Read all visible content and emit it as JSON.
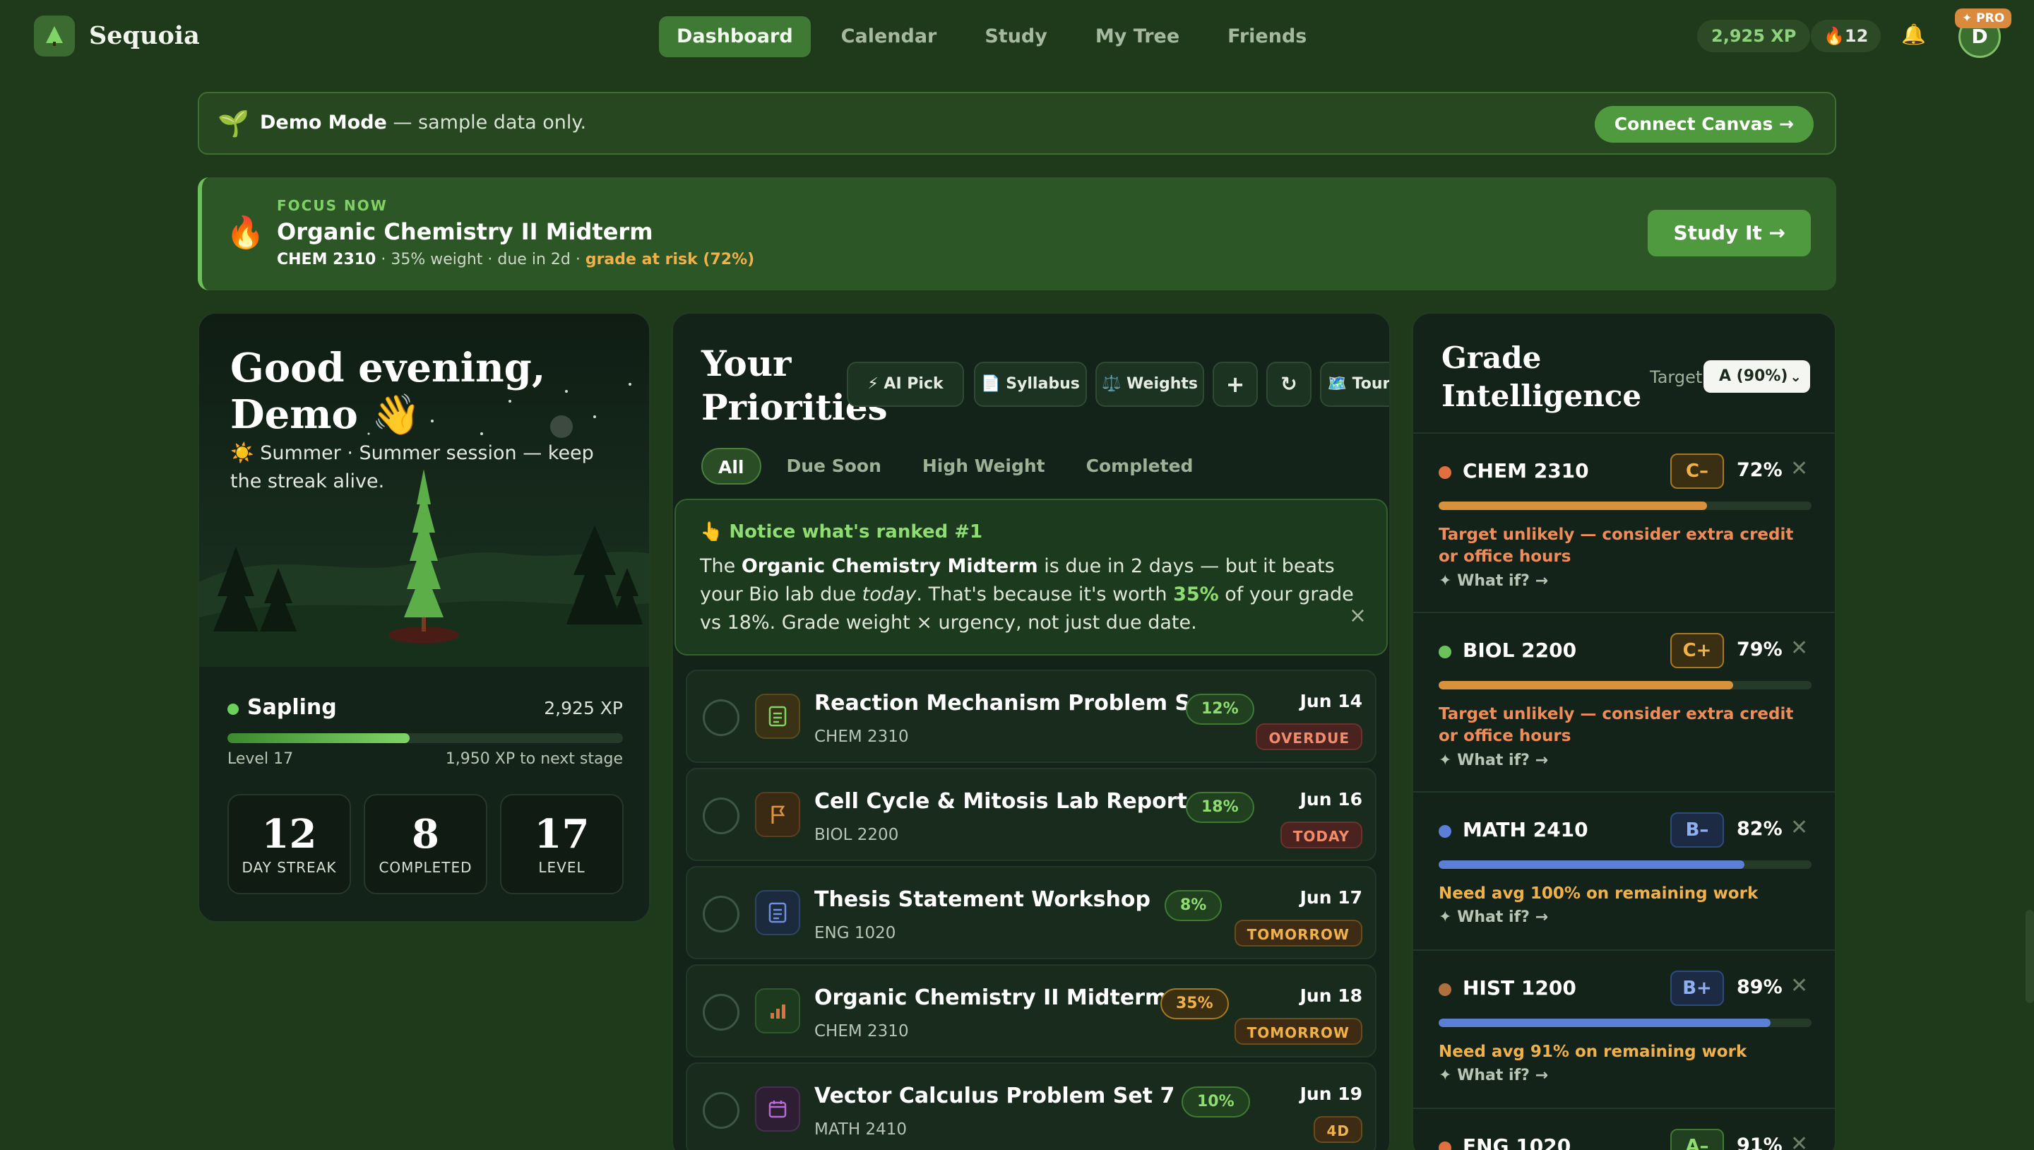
{
  "brand": {
    "name": "Sequoia"
  },
  "nav": {
    "tabs": [
      "Dashboard",
      "Calendar",
      "Study",
      "My Tree",
      "Friends"
    ],
    "active": "Dashboard"
  },
  "header": {
    "xp": "2,925 XP",
    "streak": "🔥12",
    "pro_badge": "✦ PRO",
    "avatar_initial": "D",
    "bell": "🔔"
  },
  "demo": {
    "icon": "🌱",
    "title": "Demo Mode",
    "text": "— sample data only.",
    "button": "Connect Canvas →"
  },
  "focus": {
    "icon": "🔥",
    "kicker": "FOCUS NOW",
    "title": "Organic Chemistry II Midterm",
    "course": "CHEM 2310",
    "meta": " · 35% weight · due in 2d · ",
    "risk": "grade at risk (72%)",
    "button": "Study It →"
  },
  "greeting": {
    "title": "Good evening, Demo 👋",
    "subtitle": "☀️ Summer · Summer session — keep the streak alive.",
    "stage": "Sapling",
    "xp": "2,925 XP",
    "progress": 0.46,
    "level": "Level 17",
    "next": "1,950 XP to next stage",
    "stats": [
      {
        "num": "12",
        "label": "DAY STREAK"
      },
      {
        "num": "8",
        "label": "COMPLETED"
      },
      {
        "num": "17",
        "label": "LEVEL"
      }
    ]
  },
  "priorities": {
    "title": "Your Priorities",
    "tools": {
      "ai": "⚡ AI Pick",
      "syllabus": "📄 Syllabus",
      "weights": "⚖️ Weights",
      "add": "+",
      "refresh": "↻",
      "tour": "🗺️ Tour"
    },
    "filters": [
      "All",
      "Due Soon",
      "High Weight",
      "Completed"
    ],
    "notice": {
      "heading": "👆 Notice what's ranked #1",
      "p1": "The ",
      "bold": "Organic Chemistry Midterm",
      "p2": " is due in 2 days — but it beats your Bio lab due ",
      "italic": "today",
      "p3": ". That's because it's worth ",
      "pct": "35%",
      "p4": " of your grade vs 18%. Grade weight × urgency, not just due date.",
      "close": "×"
    },
    "tasks": [
      {
        "name": "Reaction Mechanism Problem Set",
        "course": "CHEM 2310",
        "weight": "12%",
        "date": "Jun 14",
        "due": "OVERDUE",
        "icon": "doc-icon"
      },
      {
        "name": "Cell Cycle & Mitosis Lab Report",
        "course": "BIOL 2200",
        "weight": "18%",
        "date": "Jun 16",
        "due": "TODAY",
        "icon": "flag-icon"
      },
      {
        "name": "Thesis Statement Workshop",
        "course": "ENG 1020",
        "weight": "8%",
        "date": "Jun 17",
        "due": "TOMORROW",
        "icon": "page-icon"
      },
      {
        "name": "Organic Chemistry II Midterm",
        "course": "CHEM 2310",
        "weight": "35%",
        "date": "Jun 18",
        "due": "TOMORROW",
        "icon": "bar-chart-icon"
      },
      {
        "name": "Vector Calculus Problem Set 7",
        "course": "MATH 2410",
        "weight": "10%",
        "date": "Jun 19",
        "due": "4D",
        "icon": "calendar-icon"
      }
    ]
  },
  "grades": {
    "title": "Grade Intelligence",
    "target_label": "Target",
    "target_value": "A (90%)",
    "whatif": "✦ What if? →",
    "courses": [
      {
        "name": "CHEM 2310",
        "letter": "C–",
        "pct": "72%",
        "progress": 0.72,
        "note": "Target unlikely — consider extra credit or office hours",
        "dot": "#e0703e",
        "bar": "#d9923c",
        "note_color": "#f08c5a"
      },
      {
        "name": "BIOL 2200",
        "letter": "C+",
        "pct": "79%",
        "progress": 0.79,
        "note": "Target unlikely — consider extra credit or office hours",
        "dot": "#6cc25a",
        "bar": "#d9923c",
        "note_color": "#f08c5a"
      },
      {
        "name": "MATH 2410",
        "letter": "B–",
        "pct": "82%",
        "progress": 0.82,
        "note": "Need avg 100% on remaining work",
        "dot": "#5b7fd6",
        "bar": "#5b7fd6",
        "note_color": "#f0b14a"
      },
      {
        "name": "HIST 1200",
        "letter": "B+",
        "pct": "89%",
        "progress": 0.89,
        "note": "Need avg 91% on remaining work",
        "dot": "#b0703e",
        "bar": "#5b7fd6",
        "note_color": "#f0b14a"
      },
      {
        "name": "ENG 1020",
        "letter": "A–",
        "pct": "91%",
        "progress": 0.91,
        "note": "",
        "dot": "#e0703e",
        "bar": "#6cc25a",
        "note_color": "#8fdc72"
      }
    ]
  }
}
